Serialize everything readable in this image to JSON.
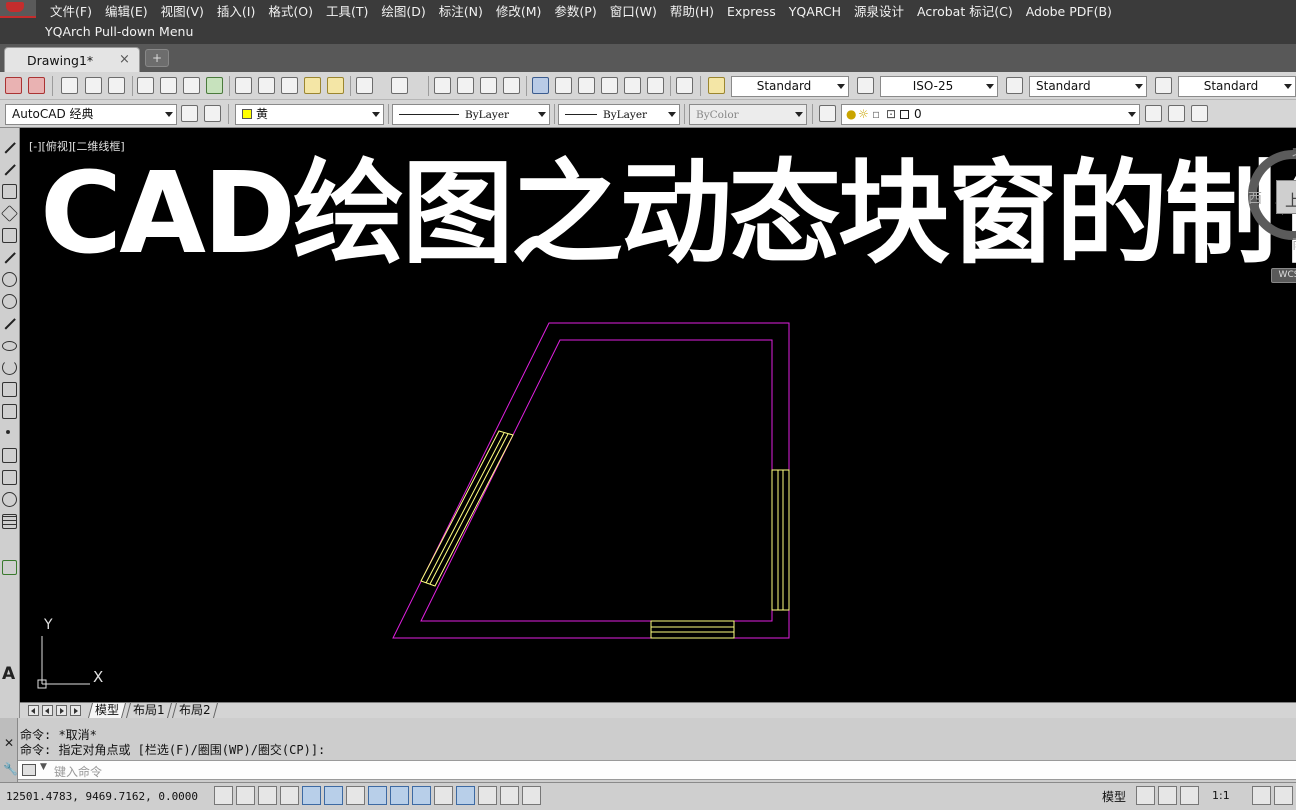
{
  "menu": {
    "items": [
      "文件(F)",
      "编辑(E)",
      "视图(V)",
      "插入(I)",
      "格式(O)",
      "工具(T)",
      "绘图(D)",
      "标注(N)",
      "修改(M)",
      "参数(P)",
      "窗口(W)",
      "帮助(H)",
      "Express",
      "YQARCH",
      "源泉设计",
      "Acrobat 标记(C)",
      "Adobe PDF(B)"
    ],
    "submenu": "YQArch Pull-down Menu"
  },
  "tabs": {
    "document": "Drawing1*",
    "close_glyph": "×",
    "new_tab_glyph": "+"
  },
  "toolbar": {
    "text_style": "Standard",
    "dim_style": "ISO-25",
    "table_style": "Standard",
    "multileader_style": "Standard",
    "workspace": "AutoCAD 经典",
    "color": "黄",
    "linetype": "ByLayer",
    "lineweight": "ByLayer",
    "plotstyle": "ByColor",
    "layer": "0"
  },
  "drawing": {
    "view_label": "[-][俯视][二维线框]",
    "overlay_title": "CAD绘图之动态块窗的制作",
    "colors": {
      "background": "#000000",
      "wall": "#e020e0",
      "window": "#ffff80"
    },
    "ucs": {
      "x_label": "X",
      "y_label": "Y"
    }
  },
  "viewcube": {
    "north": "北",
    "west": "西",
    "south": "南",
    "face": "上",
    "wcs": "WCS"
  },
  "layout_tabs": [
    "模型",
    "布局1",
    "布局2"
  ],
  "command": {
    "history": [
      "命令: *取消*",
      "命令: 指定对角点或 [栏选(F)/圈围(WP)/圈交(CP)]:"
    ],
    "placeholder": "键入命令",
    "close_glyph": "✕",
    "tool_glyph": "🔧"
  },
  "status": {
    "coordinates": "12501.4783, 9469.7162, 0.0000",
    "space": "模型",
    "annotation_scale": "1:1"
  }
}
